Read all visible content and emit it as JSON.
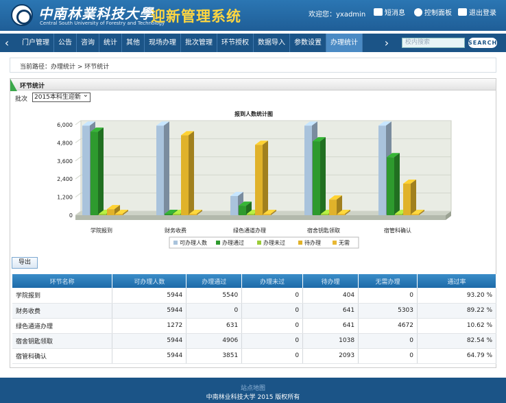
{
  "header": {
    "univ_cn": "中南林業科技大學",
    "univ_en": "Central South University of Forestry and Technology",
    "system_title": "迎新管理系统",
    "welcome": "欢迎您：yxadmin",
    "links": {
      "messages": "短消息",
      "control": "控制面板",
      "logout": "退出登录"
    }
  },
  "nav": {
    "items": [
      "门户管理",
      "公告",
      "咨询",
      "统计",
      "其他",
      "现场办理",
      "批次管理",
      "环节授权",
      "数据导入",
      "参数设置",
      "办理统计"
    ],
    "active_index": 10,
    "search_placeholder": "校内搜索",
    "search_button": "SEARCH"
  },
  "breadcrumb": "当前路径：办理统计 > 环节统计",
  "panel": {
    "title": "环节统计",
    "batch_label": "批次",
    "batch_value": "2015本科生迎新",
    "export_label": "导出"
  },
  "chart_data": {
    "type": "bar",
    "title": "报到人数统计图",
    "categories": [
      "学院报到",
      "财务收费",
      "绿色通道办理",
      "宿舍钥匙领取",
      "宿管科确认"
    ],
    "ylim": [
      0,
      6000
    ],
    "yticks": [
      "0",
      "1,200",
      "2,400",
      "3,600",
      "4,800",
      "6,000"
    ],
    "series": [
      {
        "name": "可办理人数",
        "color": "#a9c3dc",
        "values": [
          5944,
          5944,
          1272,
          5944,
          5944
        ]
      },
      {
        "name": "办理通过",
        "color": "#2e9a2e",
        "values": [
          5540,
          0,
          631,
          4906,
          3851
        ]
      },
      {
        "name": "办理未过",
        "color": "#9ccc3a",
        "values": [
          0,
          0,
          0,
          0,
          0
        ]
      },
      {
        "name": "待办理",
        "color": "#e0b22a",
        "values": [
          404,
          5303,
          4672,
          1038,
          2093
        ]
      },
      {
        "name": "无需",
        "color": "#e8b834",
        "values": [
          0,
          0,
          0,
          0,
          0
        ]
      }
    ]
  },
  "table": {
    "headers": [
      "环节名称",
      "可办理人数",
      "办理通过",
      "办理未过",
      "待办理",
      "无需办理",
      "通过率"
    ],
    "rows": [
      [
        "学院报到",
        "5944",
        "5540",
        "0",
        "404",
        "0",
        "93.20 %"
      ],
      [
        "财务收费",
        "5944",
        "0",
        "0",
        "641",
        "5303",
        "89.22 %"
      ],
      [
        "绿色通道办理",
        "1272",
        "631",
        "0",
        "641",
        "4672",
        "10.62 %"
      ],
      [
        "宿舍钥匙领取",
        "5944",
        "4906",
        "0",
        "1038",
        "0",
        "82.54 %"
      ],
      [
        "宿管科确认",
        "5944",
        "3851",
        "0",
        "2093",
        "0",
        "64.79 %"
      ]
    ]
  },
  "footer": {
    "sitemap": "站点地图",
    "copyright": "中南林业科技大学 2015 版权所有"
  }
}
